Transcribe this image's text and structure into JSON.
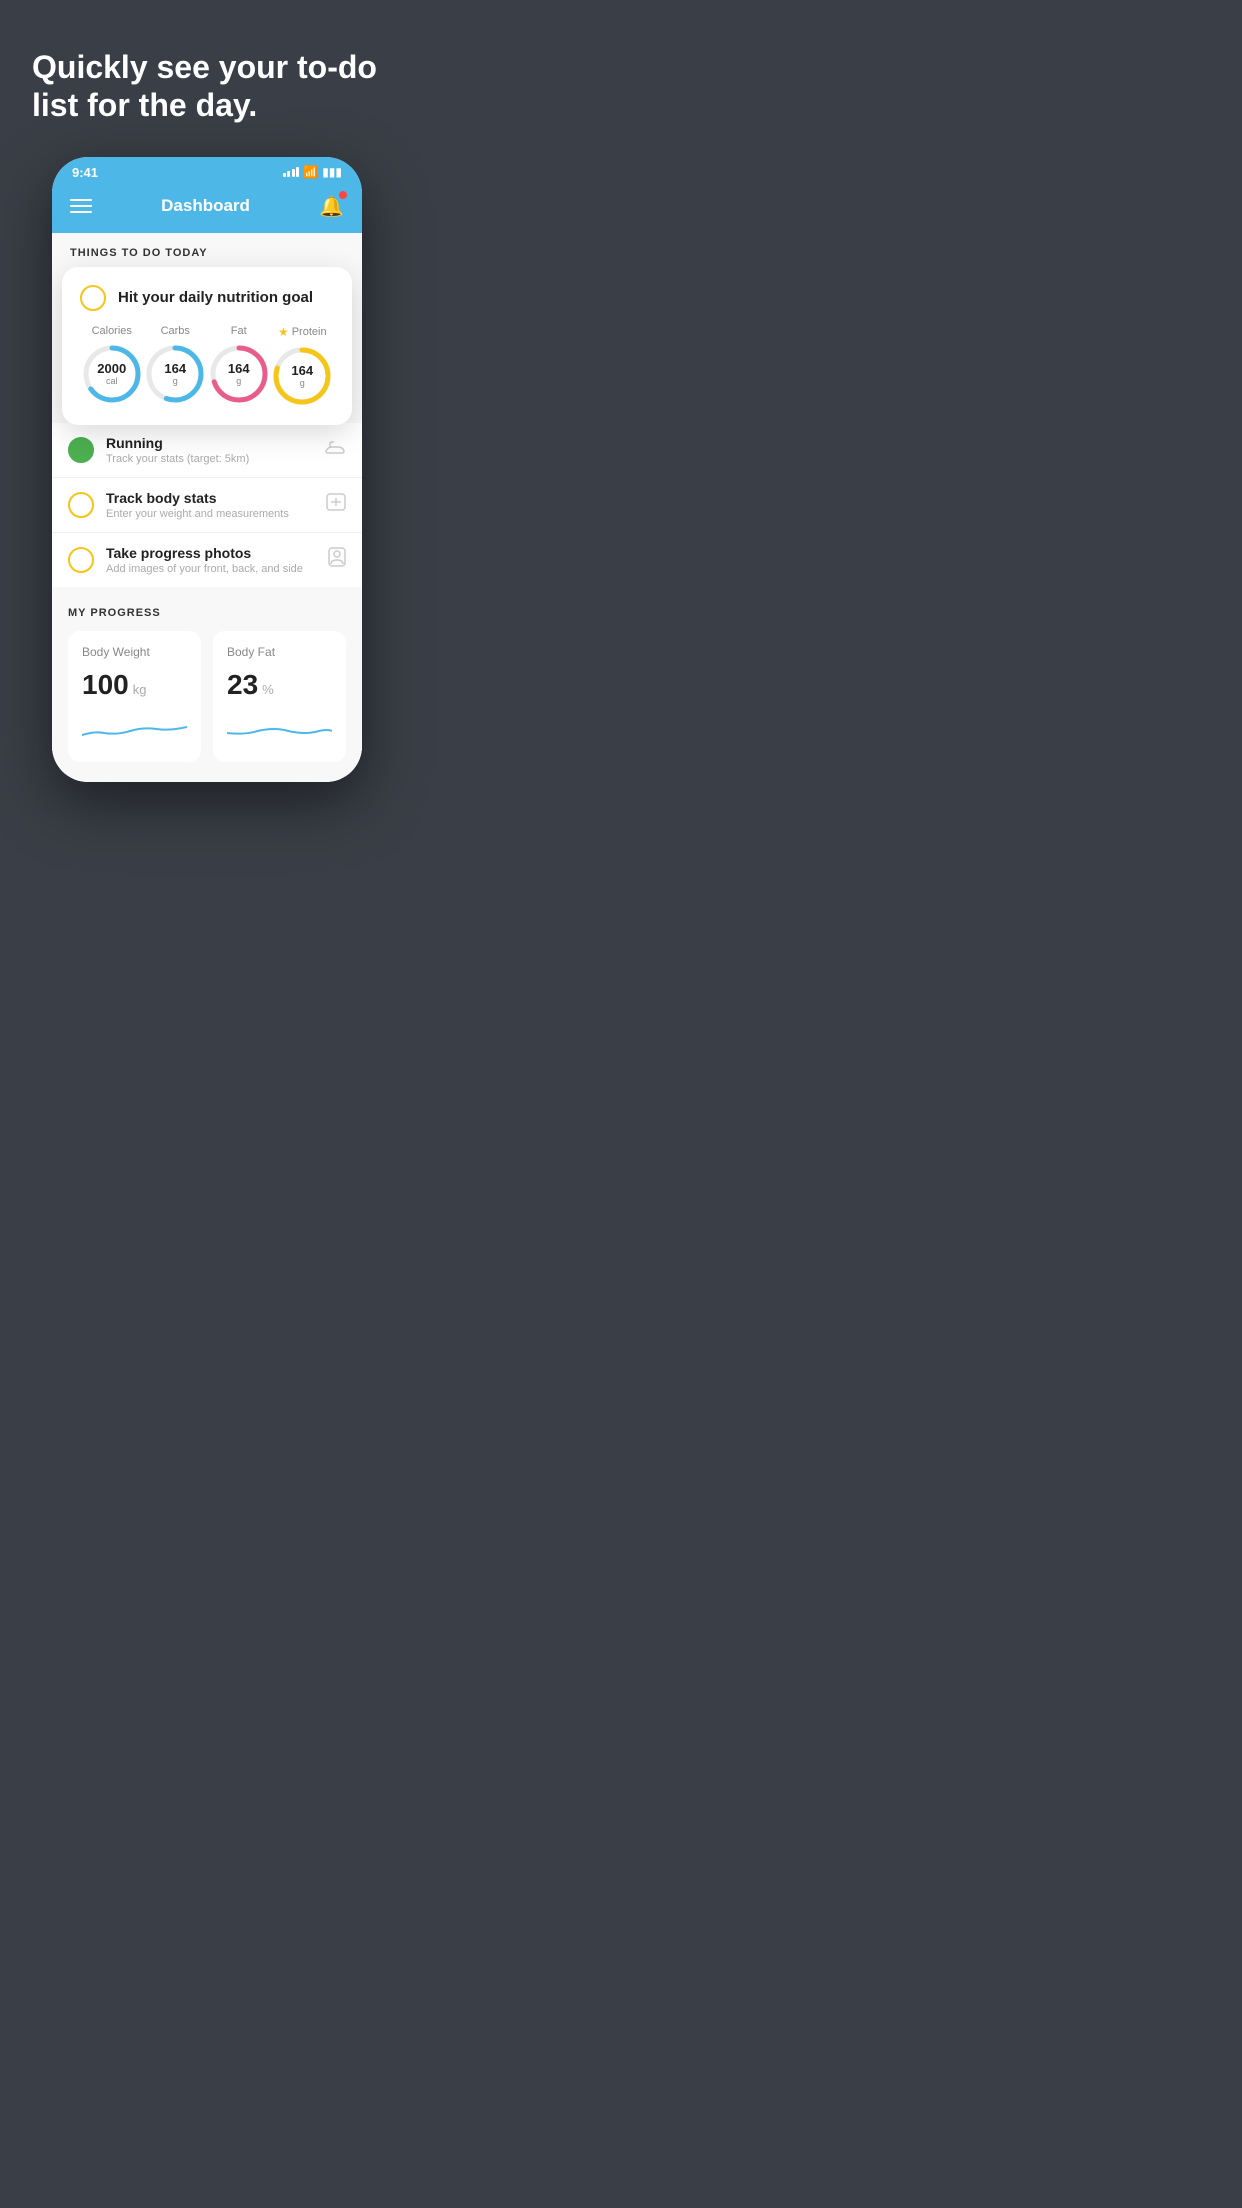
{
  "hero": {
    "title": "Quickly see your to-do list for the day."
  },
  "status_bar": {
    "time": "9:41"
  },
  "app_header": {
    "title": "Dashboard"
  },
  "things_to_do": {
    "section_label": "THINGS TO DO TODAY",
    "nutrition_card": {
      "title": "Hit your daily nutrition goal",
      "items": [
        {
          "label": "Calories",
          "value": "2000",
          "unit": "cal",
          "color": "#4db8e8",
          "percent": 65,
          "star": false
        },
        {
          "label": "Carbs",
          "value": "164",
          "unit": "g",
          "color": "#4db8e8",
          "percent": 55,
          "star": false
        },
        {
          "label": "Fat",
          "value": "164",
          "unit": "g",
          "color": "#e85d8a",
          "percent": 70,
          "star": false
        },
        {
          "label": "Protein",
          "value": "164",
          "unit": "g",
          "color": "#f5c518",
          "percent": 80,
          "star": true
        }
      ]
    },
    "todo_items": [
      {
        "title": "Running",
        "subtitle": "Track your stats (target: 5km)",
        "checkbox_type": "green",
        "icon": "shoe"
      },
      {
        "title": "Track body stats",
        "subtitle": "Enter your weight and measurements",
        "checkbox_type": "yellow",
        "icon": "scale"
      },
      {
        "title": "Take progress photos",
        "subtitle": "Add images of your front, back, and side",
        "checkbox_type": "yellow",
        "icon": "person"
      }
    ]
  },
  "progress": {
    "section_label": "MY PROGRESS",
    "cards": [
      {
        "title": "Body Weight",
        "value": "100",
        "unit": "kg"
      },
      {
        "title": "Body Fat",
        "value": "23",
        "unit": "%"
      }
    ]
  }
}
